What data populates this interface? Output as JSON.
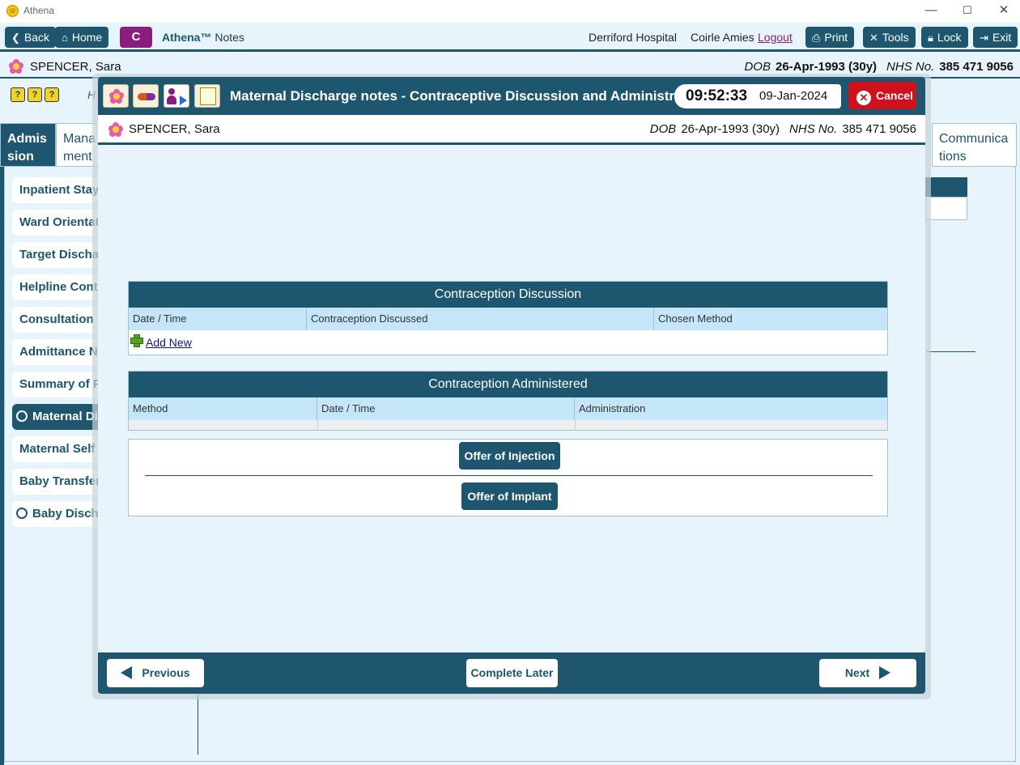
{
  "window": {
    "title": "Athena",
    "minimize": "—",
    "maximize": "☐",
    "close": "✕"
  },
  "toolbar": {
    "back": "Back",
    "home": "Home",
    "c_label": "C",
    "app_name": "Athena™",
    "app_suffix": "Notes",
    "hospital": "Derriford Hospital",
    "user": "Coirle Amies",
    "logout": "Logout",
    "print": "Print",
    "tools": "Tools",
    "lock": "Lock",
    "exit": "Exit"
  },
  "patient": {
    "name": "SPENCER, Sara",
    "dob_label": "DOB",
    "dob": "26-Apr-1993 (30y)",
    "nhs_label": "NHS No.",
    "nhs": "385 471 9056"
  },
  "help_icons": [
    "?",
    "?",
    "?"
  ],
  "bg_letter": "H",
  "tabs": [
    {
      "label": "Admis sion"
    },
    {
      "label": "Mana ment"
    },
    {
      "label": "Communica tions"
    }
  ],
  "nav": [
    {
      "label": "Inpatient Stay"
    },
    {
      "label": "Ward Orientat"
    },
    {
      "label": "Target Dischar"
    },
    {
      "label": "Helpline Cont"
    },
    {
      "label": "Consultation I"
    },
    {
      "label": "Admittance N"
    },
    {
      "label": "Summary of P"
    },
    {
      "label": "Maternal Di"
    },
    {
      "label": "Maternal Self"
    },
    {
      "label": "Baby Transfer"
    },
    {
      "label": "Baby Discha"
    }
  ],
  "modal": {
    "title": "Maternal Discharge notes - Contraceptive Discussion and Administration",
    "time": "09:52:33",
    "date": "09-Jan-2024",
    "cancel": "Cancel",
    "discussion": {
      "heading": "Contraception Discussion",
      "columns": [
        "Date / Time",
        "Contraception Discussed",
        "Chosen Method"
      ],
      "add_new": "Add New"
    },
    "administered": {
      "heading": "Contraception Administered",
      "columns": [
        "Method",
        "Date / Time",
        "Administration"
      ]
    },
    "offer_injection": "Offer of Injection",
    "offer_implant": "Offer of Implant",
    "footer": {
      "previous": "Previous",
      "complete_later": "Complete Later",
      "next": "Next"
    }
  },
  "colors": {
    "primary": "#1d566e",
    "accent": "#8b1d7e",
    "cancel": "#d0111b",
    "header_row": "#c4e6f8",
    "background": "#e8f4fb"
  }
}
